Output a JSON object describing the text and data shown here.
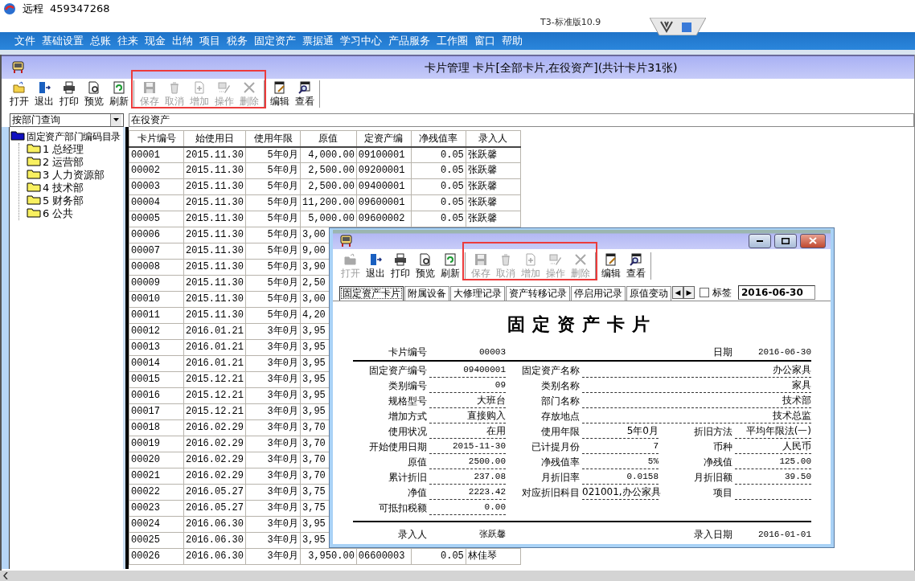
{
  "app": {
    "title": "远程",
    "id": "459347268",
    "edition": "T3-标准版10.9"
  },
  "menu": [
    "文件",
    "基础设置",
    "总账",
    "往来",
    "现金",
    "出纳",
    "项目",
    "税务",
    "固定资产",
    "票据通",
    "学习中心",
    "产品服务",
    "工作圈",
    "窗口",
    "帮助"
  ],
  "main_window": {
    "title": "卡片管理 卡片[全部卡片,在役资产](共计卡片31张)",
    "toolbar": [
      {
        "highlight": false,
        "items": [
          {
            "kind": "open",
            "label": "打开",
            "disabled": false
          },
          {
            "kind": "exit",
            "label": "退出",
            "disabled": false
          },
          {
            "kind": "print",
            "label": "打印",
            "disabled": false
          },
          {
            "kind": "preview",
            "label": "预览",
            "disabled": false
          },
          {
            "kind": "refresh",
            "label": "刷新",
            "disabled": false
          }
        ]
      },
      {
        "highlight": true,
        "items": [
          {
            "kind": "save",
            "label": "保存",
            "disabled": true
          },
          {
            "kind": "cancel",
            "label": "取消",
            "disabled": true
          },
          {
            "kind": "add",
            "label": "增加",
            "disabled": true
          },
          {
            "kind": "operate",
            "label": "操作",
            "disabled": true
          },
          {
            "kind": "delete",
            "label": "删除",
            "disabled": true
          }
        ]
      },
      {
        "highlight": false,
        "items": [
          {
            "kind": "edit",
            "label": "编辑",
            "disabled": false
          },
          {
            "kind": "view",
            "label": "查看",
            "disabled": false
          }
        ]
      }
    ],
    "query": {
      "value": "按部门查询"
    },
    "status_label": "在役资产",
    "tree": {
      "label": "固定资产部门编码目录",
      "children": [
        {
          "label": "1 总经理"
        },
        {
          "label": "2 运营部"
        },
        {
          "label": "3 人力资源部"
        },
        {
          "label": "4 技术部"
        },
        {
          "label": "5 财务部"
        },
        {
          "label": "6 公共"
        }
      ]
    },
    "table": {
      "columns": [
        "卡片编号",
        "始使用日",
        "使用年限",
        "原值",
        "定资产编",
        "净残值率",
        "录入人"
      ],
      "rows": [
        [
          "00001",
          "2015.11.30",
          "5年0月",
          "4,000.00",
          "09100001",
          "0.05",
          "张跃馨"
        ],
        [
          "00002",
          "2015.11.30",
          "5年0月",
          "2,500.00",
          "09200001",
          "0.05",
          "张跃馨"
        ],
        [
          "00003",
          "2015.11.30",
          "5年0月",
          "2,500.00",
          "09400001",
          "0.05",
          "张跃馨"
        ],
        [
          "00004",
          "2015.11.30",
          "5年0月",
          "11,200.00",
          "09600001",
          "0.05",
          "张跃馨"
        ],
        [
          "00005",
          "2015.11.30",
          "5年0月",
          "5,000.00",
          "09600002",
          "0.05",
          "张跃馨"
        ],
        [
          "00006",
          "2015.11.30",
          "5年0月",
          "3,00"
        ],
        [
          "00007",
          "2015.11.30",
          "5年0月",
          "9,00"
        ],
        [
          "00008",
          "2015.11.30",
          "5年0月",
          "3,90"
        ],
        [
          "00009",
          "2015.11.30",
          "5年0月",
          "2,50"
        ],
        [
          "00010",
          "2015.11.30",
          "5年0月",
          "3,00"
        ],
        [
          "00011",
          "2015.11.30",
          "5年0月",
          "4,20"
        ],
        [
          "00012",
          "2016.01.21",
          "3年0月",
          "3,95"
        ],
        [
          "00013",
          "2016.01.21",
          "3年0月",
          "3,95"
        ],
        [
          "00014",
          "2016.01.21",
          "3年0月",
          "3,95"
        ],
        [
          "00015",
          "2015.12.21",
          "3年0月",
          "3,95"
        ],
        [
          "00016",
          "2015.12.21",
          "3年0月",
          "3,95"
        ],
        [
          "00017",
          "2015.12.21",
          "3年0月",
          "3,95"
        ],
        [
          "00018",
          "2016.02.29",
          "3年0月",
          "3,70"
        ],
        [
          "00019",
          "2016.02.29",
          "3年0月",
          "3,70"
        ],
        [
          "00020",
          "2016.02.29",
          "3年0月",
          "3,70"
        ],
        [
          "00021",
          "2016.02.29",
          "3年0月",
          "3,70"
        ],
        [
          "00022",
          "2016.05.27",
          "3年0月",
          "3,75"
        ],
        [
          "00023",
          "2016.05.27",
          "3年0月",
          "3,75"
        ],
        [
          "00024",
          "2016.06.30",
          "3年0月",
          "3,95"
        ],
        [
          "00025",
          "2016.06.30",
          "3年0月",
          "3,95"
        ],
        [
          "00026",
          "2016.06.30",
          "3年0月",
          "3,950.00",
          "06600003",
          "0.05",
          "林佳琴"
        ]
      ]
    }
  },
  "dialog": {
    "toolbar": [
      {
        "highlight": false,
        "items": [
          {
            "kind": "open",
            "label": "打开",
            "disabled": true
          },
          {
            "kind": "exit",
            "label": "退出",
            "disabled": false
          },
          {
            "kind": "print",
            "label": "打印",
            "disabled": false
          },
          {
            "kind": "preview",
            "label": "预览",
            "disabled": false
          },
          {
            "kind": "refresh",
            "label": "刷新",
            "disabled": false
          }
        ]
      },
      {
        "highlight": true,
        "items": [
          {
            "kind": "save",
            "label": "保存",
            "disabled": true
          },
          {
            "kind": "cancel",
            "label": "取消",
            "disabled": true
          },
          {
            "kind": "add",
            "label": "增加",
            "disabled": true
          },
          {
            "kind": "operate",
            "label": "操作",
            "disabled": true
          },
          {
            "kind": "delete",
            "label": "删除",
            "disabled": true
          }
        ]
      },
      {
        "highlight": false,
        "items": [
          {
            "kind": "edit",
            "label": "编辑",
            "disabled": false
          },
          {
            "kind": "view",
            "label": "查看",
            "disabled": false
          }
        ]
      }
    ],
    "tabs": [
      {
        "label": "固定资产卡片",
        "selected": true
      },
      {
        "label": "附属设备",
        "selected": false
      },
      {
        "label": "大修理记录",
        "selected": false
      },
      {
        "label": "资产转移记录",
        "selected": false
      },
      {
        "label": "停启用记录",
        "selected": false
      },
      {
        "label": "原值变动",
        "selected": false
      }
    ],
    "tab_scroll": [
      "◀",
      "▶"
    ],
    "tag_checkbox": {
      "label": "标签",
      "checked": false
    },
    "date": "2016-06-30",
    "card": {
      "title": "固定资产卡片",
      "header": [
        {
          "label": "卡片编号",
          "value": "00003"
        },
        {
          "label": "日期",
          "value": "2016-06-30"
        }
      ],
      "fields": [
        [
          {
            "label": "固定资产编号",
            "value": "09400001",
            "wide": false
          },
          {
            "label": "固定资产名称",
            "value": "办公家具",
            "wide": true
          }
        ],
        [
          {
            "label": "类别编号",
            "value": "09",
            "wide": false
          },
          {
            "label": "类别名称",
            "value": "家具",
            "wide": true
          }
        ],
        [
          {
            "label": "规格型号",
            "value": "大班台",
            "wide": false
          },
          {
            "label": "部门名称",
            "value": "技术部",
            "wide": true
          }
        ],
        [
          {
            "label": "增加方式",
            "value": "直接购入",
            "wide": false
          },
          {
            "label": "存放地点",
            "value": "技术总监",
            "wide": true
          }
        ],
        [
          {
            "label": "使用状况",
            "value": "在用",
            "wide": false
          },
          {
            "label": "使用年限",
            "value": "5年0月",
            "wide": false
          },
          {
            "label": "折旧方法",
            "value": "平均年限法(一)",
            "wide": false
          }
        ],
        [
          {
            "label": "开始使用日期",
            "value": "2015-11-30",
            "wide": false
          },
          {
            "label": "已计提月份",
            "value": "7",
            "wide": false
          },
          {
            "label": "币种",
            "value": "人民币",
            "wide": false
          }
        ],
        [
          {
            "label": "原值",
            "value": "2500.00",
            "wide": false
          },
          {
            "label": "净残值率",
            "value": "5%",
            "wide": false
          },
          {
            "label": "净残值",
            "value": "125.00",
            "wide": false
          }
        ],
        [
          {
            "label": "累计折旧",
            "value": "237.08",
            "wide": false
          },
          {
            "label": "月折旧率",
            "value": "0.0158",
            "wide": false
          },
          {
            "label": "月折旧额",
            "value": "39.50",
            "wide": false
          }
        ],
        [
          {
            "label": "净值",
            "value": "2223.42",
            "wide": false
          },
          {
            "label": "对应折旧科目",
            "value": "021001,办公家具",
            "wide": false
          },
          {
            "label": "项目",
            "wide": false
          }
        ],
        [
          {
            "label": "可抵扣税额",
            "value": "0.00",
            "wide": false
          }
        ]
      ],
      "footer": [
        {
          "label": "录入人",
          "value": "张跃馨"
        },
        {
          "label": "录入日期",
          "value": "2016-01-01"
        }
      ]
    }
  }
}
